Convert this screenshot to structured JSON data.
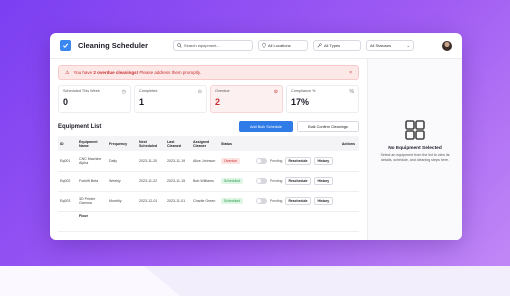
{
  "app": {
    "title": "Cleaning Scheduler"
  },
  "search": {
    "placeholder": "Search equipment..."
  },
  "filters": {
    "locations": "All Locations",
    "types": "All Types",
    "statuses": "All Statuses"
  },
  "alert": {
    "prefix": "You have ",
    "highlight": "2 overdue cleanings!",
    "suffix": " Please address them promptly."
  },
  "stats": [
    {
      "label": "Scheduled This Week",
      "value": "0"
    },
    {
      "label": "Completed",
      "value": "1"
    },
    {
      "label": "Overdue",
      "value": "2"
    },
    {
      "label": "Compliance %",
      "value": "17%"
    }
  ],
  "list": {
    "title": "Equipment List",
    "add_bulk": "Add Bulk Schedule",
    "bulk_confirm": "Bulk Confirm Cleanings",
    "headers": [
      "ID",
      "Equipment Name",
      "Frequency",
      "Next Scheduled",
      "Last Cleaned",
      "Assigned Cleaner",
      "Status",
      "Actions"
    ],
    "rows": [
      {
        "id": "Eq001",
        "name": "CNC Machine Alpha",
        "frequency": "Daily",
        "next": "2023-11-20",
        "last": "2023-11-19",
        "cleaner": "Alice Johnson",
        "status": "Overdue",
        "pending": "Pending",
        "reschedule": "Reschedule",
        "history": "History"
      },
      {
        "id": "Eq002",
        "name": "Forklift Beta",
        "frequency": "Weekly",
        "next": "2023-11-22",
        "last": "2023-11-15",
        "cleaner": "Bob Williams",
        "status": "Scheduled",
        "pending": "Pending",
        "reschedule": "Reschedule",
        "history": "History"
      },
      {
        "id": "Eq003",
        "name": "3D Printer Gamma",
        "frequency": "Monthly",
        "next": "2023-12-01",
        "last": "2023-11-01",
        "cleaner": "Charlie Green",
        "status": "Scheduled",
        "pending": "Pending",
        "reschedule": "Reschedule",
        "history": "History"
      },
      {
        "id": "",
        "name": "Floor",
        "frequency": "",
        "next": "",
        "last": "",
        "cleaner": "",
        "status": "",
        "pending": "",
        "reschedule": "",
        "history": ""
      }
    ]
  },
  "empty": {
    "title": "No Equipment Selected",
    "text": "Select an equipment from the list to view its details, schedule, and cleaning steps here."
  },
  "colors": {
    "accent": "#2f7be8",
    "danger": "#c62f2f",
    "success": "#2b9a4a"
  }
}
